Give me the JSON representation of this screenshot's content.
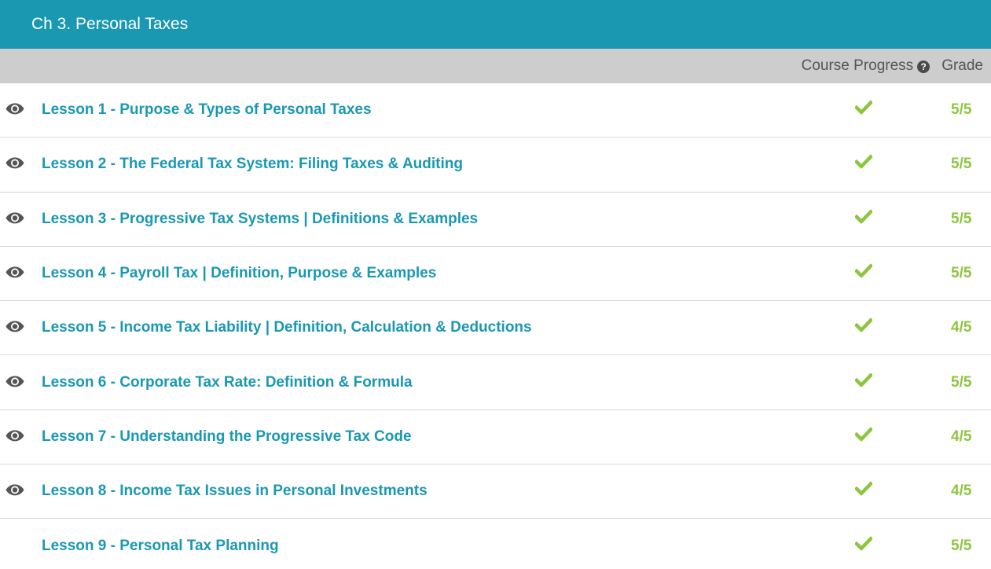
{
  "header": {
    "chapter_title": "Ch 3. Personal Taxes"
  },
  "columns": {
    "progress_label": "Course Progress",
    "help_icon": "?",
    "grade_label": "Grade"
  },
  "colors": {
    "brand": "#1a98b2",
    "complete": "#8cc63f",
    "header_band": "#cdcdcd"
  },
  "lessons": [
    {
      "title": "Lesson 1 - Purpose & Types of Personal Taxes",
      "viewed_icon": "eye-icon",
      "complete": true,
      "grade": "5/5"
    },
    {
      "title": "Lesson 2 - The Federal Tax System: Filing Taxes & Auditing",
      "viewed_icon": "eye-icon",
      "complete": true,
      "grade": "5/5"
    },
    {
      "title": "Lesson 3 - Progressive Tax Systems | Definitions & Examples",
      "viewed_icon": "eye-icon",
      "complete": true,
      "grade": "5/5"
    },
    {
      "title": "Lesson 4 - Payroll Tax | Definition, Purpose & Examples",
      "viewed_icon": "eye-icon",
      "complete": true,
      "grade": "5/5"
    },
    {
      "title": "Lesson 5 - Income Tax Liability | Definition, Calculation & Deductions",
      "viewed_icon": "eye-icon",
      "complete": true,
      "grade": "4/5"
    },
    {
      "title": "Lesson 6 - Corporate Tax Rate: Definition & Formula",
      "viewed_icon": "eye-icon",
      "complete": true,
      "grade": "5/5"
    },
    {
      "title": "Lesson 7 - Understanding the Progressive Tax Code",
      "viewed_icon": "eye-icon",
      "complete": true,
      "grade": "4/5"
    },
    {
      "title": "Lesson 8 - Income Tax Issues in Personal Investments",
      "viewed_icon": "eye-icon",
      "complete": true,
      "grade": "4/5"
    },
    {
      "title": "Lesson 9 - Personal Tax Planning",
      "viewed_icon": "",
      "complete": true,
      "grade": "5/5"
    }
  ]
}
